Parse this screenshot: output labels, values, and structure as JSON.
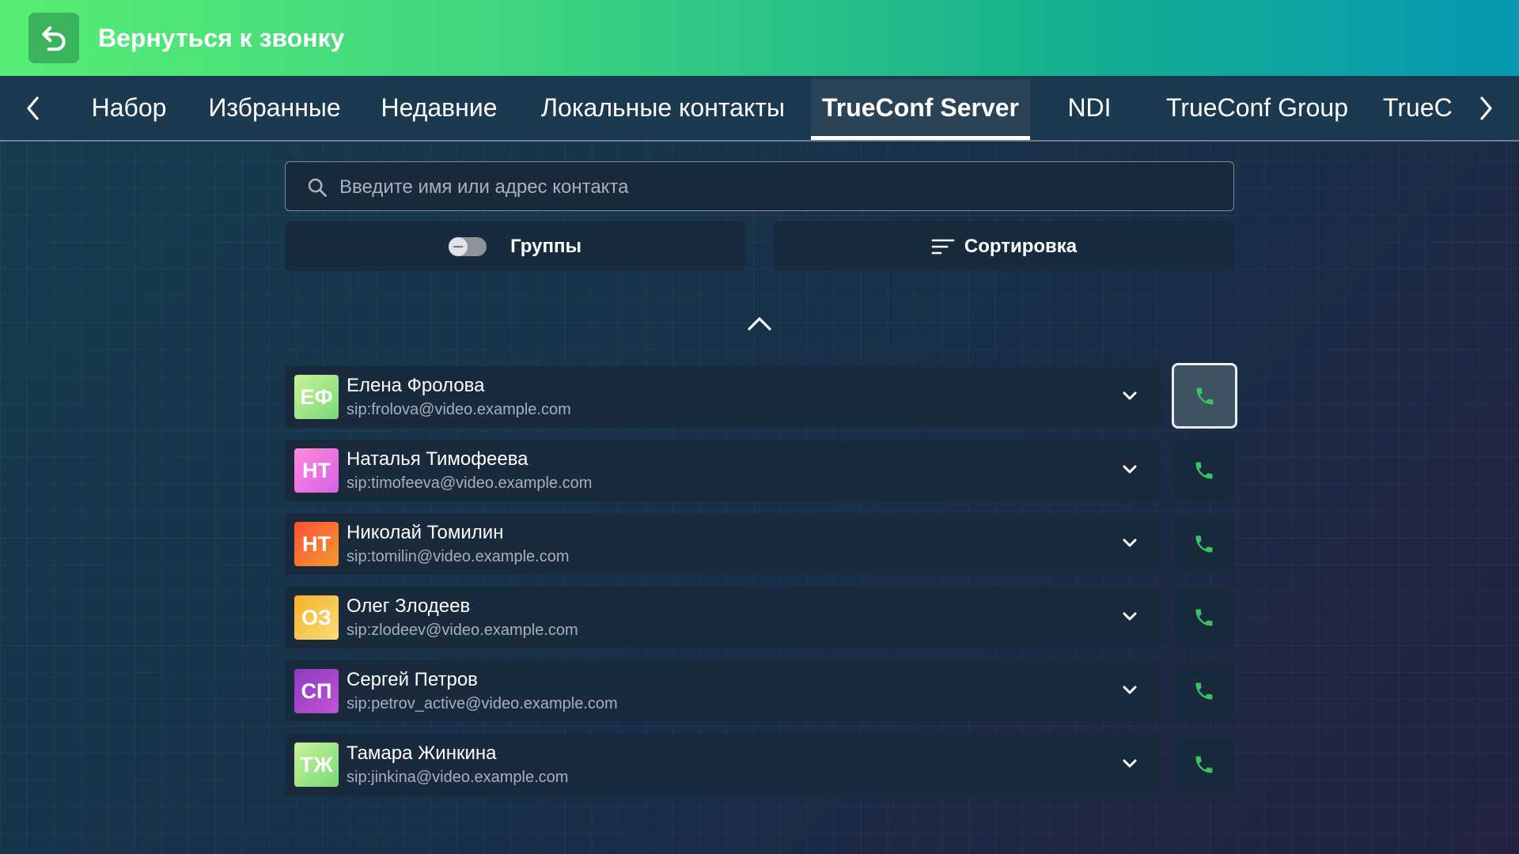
{
  "topbar": {
    "title": "Вернуться к звонку",
    "back_icon": "undo-arrow-icon"
  },
  "tabs": [
    {
      "label": "Набор",
      "active": false
    },
    {
      "label": "Избранные",
      "active": false
    },
    {
      "label": "Недавние",
      "active": false
    },
    {
      "label": "Локальные контакты",
      "active": false
    },
    {
      "label": "TrueConf Server",
      "active": true
    },
    {
      "label": "NDI",
      "active": false
    },
    {
      "label": "TrueConf Group",
      "active": false
    },
    {
      "label": "TrueC",
      "active": false
    }
  ],
  "search": {
    "placeholder": "Введите имя или адрес контакта",
    "value": ""
  },
  "controls": {
    "groups_label": "Группы",
    "groups_enabled": false,
    "sort_label": "Сортировка"
  },
  "contacts": [
    {
      "initials": "ЕФ",
      "name": "Елена Фролова",
      "address": "sip:frolova@video.example.com"
    },
    {
      "initials": "НТ",
      "name": "Наталья Тимофеева",
      "address": "sip:timofeeva@video.example.com"
    },
    {
      "initials": "НТ",
      "name": "Николай Томилин",
      "address": "sip:tomilin@video.example.com"
    },
    {
      "initials": "ОЗ",
      "name": "Олег Злодеев",
      "address": "sip:zlodeev@video.example.com"
    },
    {
      "initials": "СП",
      "name": "Сергей Петров",
      "address": "sip:petrov_active@video.example.com"
    },
    {
      "initials": "ТЖ",
      "name": "Тамара Жинкина",
      "address": "sip:jinkina@video.example.com"
    }
  ],
  "colors": {
    "accent_green": "#3bb35a",
    "call_icon": "#39c463",
    "avatars": [
      "#9be07a",
      "#e86bd8",
      "#f06a3a",
      "#f5c23a",
      "#9b3fc4",
      "#9be07a"
    ]
  }
}
